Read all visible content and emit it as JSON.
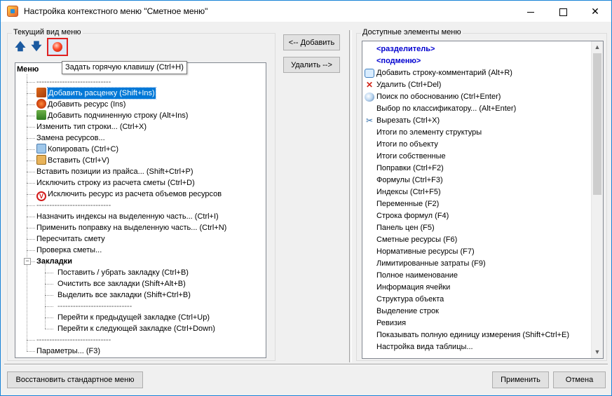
{
  "window": {
    "title": "Настройка контекстного меню \"Сметное меню\""
  },
  "left": {
    "group_label": "Текущий вид меню",
    "tooltip": "Задать горячую клавишу (Ctrl+H)",
    "root_label": "Меню",
    "items": [
      {
        "label": "-----------------------------",
        "kind": "sep"
      },
      {
        "label": "Добавить расценку (Shift+Ins)",
        "icon": "rate",
        "selected": true
      },
      {
        "label": "Добавить ресурс (Ins)",
        "icon": "res"
      },
      {
        "label": "Добавить подчиненную строку (Alt+Ins)",
        "icon": "sub"
      },
      {
        "label": "Изменить тип строки... (Ctrl+X)"
      },
      {
        "label": "Замена ресурсов..."
      },
      {
        "label": "Копировать (Ctrl+C)",
        "icon": "copy"
      },
      {
        "label": "Вставить (Ctrl+V)",
        "icon": "paste"
      },
      {
        "label": "Вставить позиции из прайса... (Shift+Ctrl+P)"
      },
      {
        "label": "Исключить строку из расчета сметы (Ctrl+D)"
      },
      {
        "label": "Исключить ресурс из расчета объемов ресурсов",
        "icon": "excl"
      },
      {
        "label": "-----------------------------",
        "kind": "sep"
      },
      {
        "label": "Назначить индексы на выделенную часть... (Ctrl+I)"
      },
      {
        "label": "Применить поправку на выделенную часть... (Ctrl+N)"
      },
      {
        "label": "Пересчитать смету"
      },
      {
        "label": "Проверка сметы..."
      },
      {
        "label": "Закладки",
        "kind": "group"
      },
      {
        "label": "Поставить / убрать закладку (Ctrl+B)",
        "kind": "child"
      },
      {
        "label": "Очистить все закладки (Shift+Alt+B)",
        "kind": "child"
      },
      {
        "label": "Выделить все закладки (Shift+Ctrl+B)",
        "kind": "child"
      },
      {
        "label": "-----------------------------",
        "kind": "childsep"
      },
      {
        "label": "Перейти к предыдущей закладке (Ctrl+Up)",
        "kind": "child"
      },
      {
        "label": "Перейти к следующей закладке (Ctrl+Down)",
        "kind": "child"
      },
      {
        "label": "-----------------------------",
        "kind": "sep"
      },
      {
        "label": "Параметры... (F3)"
      }
    ]
  },
  "middle": {
    "add_label": "<-- Добавить",
    "remove_label": "Удалить -->"
  },
  "right": {
    "group_label": "Доступные элементы меню",
    "items": [
      {
        "label": "<разделитель>",
        "special": true
      },
      {
        "label": "<подменю>",
        "special": true
      },
      {
        "label": "Добавить строку-комментарий (Alt+R)",
        "icon": "comment"
      },
      {
        "label": "Удалить (Ctrl+Del)",
        "icon": "delete"
      },
      {
        "label": "Поиск по обоснованию (Ctrl+Enter)",
        "icon": "find"
      },
      {
        "label": "Выбор по классификатору... (Alt+Enter)"
      },
      {
        "label": "Вырезать (Ctrl+X)",
        "icon": "cut"
      },
      {
        "label": "Итоги по элементу структуры"
      },
      {
        "label": "Итоги по объекту"
      },
      {
        "label": "Итоги собственные"
      },
      {
        "label": "Поправки (Ctrl+F2)"
      },
      {
        "label": "Формулы (Ctrl+F3)"
      },
      {
        "label": "Индексы (Ctrl+F5)"
      },
      {
        "label": "Переменные (F2)"
      },
      {
        "label": "Строка формул (F4)"
      },
      {
        "label": "Панель цен (F5)"
      },
      {
        "label": "Сметные ресурсы (F6)"
      },
      {
        "label": "Нормативные ресурсы (F7)"
      },
      {
        "label": "Лимитированные затраты (F9)"
      },
      {
        "label": "Полное наименование"
      },
      {
        "label": "Информация ячейки"
      },
      {
        "label": "Структура объекта"
      },
      {
        "label": "Выделение строк"
      },
      {
        "label": "Ревизия"
      },
      {
        "label": "Показывать полную единицу измерения (Shift+Ctrl+E)"
      },
      {
        "label": "Настройка вида таблицы..."
      }
    ]
  },
  "footer": {
    "restore_label": "Восстановить стандартное меню",
    "apply_label": "Применить",
    "cancel_label": "Отмена"
  }
}
